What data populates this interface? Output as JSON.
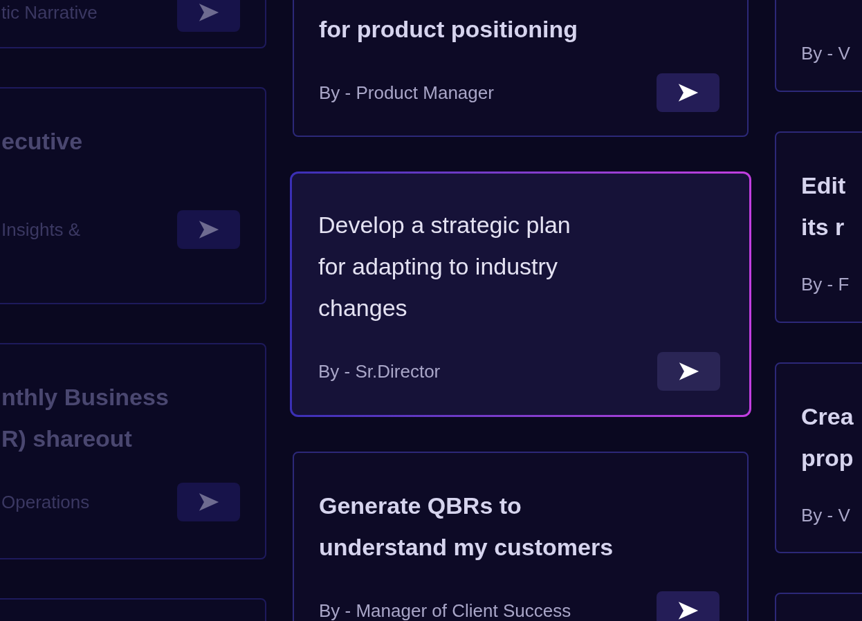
{
  "columns": [
    {
      "dimmed": true,
      "cards": [
        {
          "byline": "tic Narrative",
          "highlighted": false,
          "send_button": true
        },
        {
          "title_lines": [
            "ecutive"
          ],
          "byline": "Insights &",
          "highlighted": false,
          "send_button": true
        },
        {
          "title_lines": [
            "nthly Business",
            "R) shareout"
          ],
          "byline": "Operations",
          "highlighted": false,
          "send_button": true
        },
        {
          "highlighted": false
        }
      ]
    },
    {
      "dimmed": false,
      "cards": [
        {
          "title_lines": [
            "for product positioning"
          ],
          "byline": "By - Product Manager",
          "highlighted": false,
          "send_button": true
        },
        {
          "title_lines": [
            "Develop a strategic plan",
            "for adapting to industry",
            "changes"
          ],
          "byline": "By - Sr.Director",
          "highlighted": true,
          "send_button": true
        },
        {
          "title_lines": [
            "Generate QBRs to",
            "understand my customers"
          ],
          "byline": "By - Manager of Client Success",
          "highlighted": false,
          "send_button": true
        }
      ]
    },
    {
      "dimmed": false,
      "cards": [
        {
          "byline": "By - V",
          "highlighted": false
        },
        {
          "title_lines": [
            "Edit",
            "its r"
          ],
          "byline": "By - F",
          "highlighted": false
        },
        {
          "title_lines": [
            "Crea",
            "prop"
          ],
          "byline": "By - V",
          "highlighted": false
        },
        {
          "highlighted": false
        }
      ]
    }
  ]
}
